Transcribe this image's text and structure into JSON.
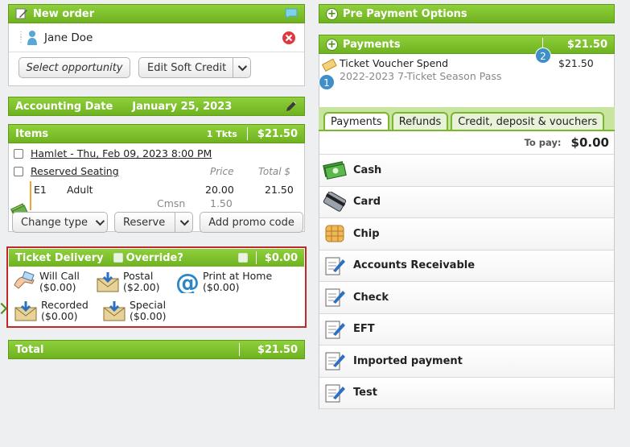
{
  "new_order": {
    "title": "New order",
    "customer": "Jane Doe",
    "select_opportunity": "Select opportunity",
    "edit_soft_credit": "Edit Soft Credit"
  },
  "accounting": {
    "label": "Accounting Date",
    "date": "January 25, 2023"
  },
  "items": {
    "title": "Items",
    "tkts": "1 Tkts",
    "amount": "$21.50",
    "event": "Hamlet - Thu, Feb 09, 2023 8:00 PM",
    "seating": "Reserved Seating",
    "price_header": "Price",
    "total_header": "Total $",
    "seat": "E1",
    "type": "Adult",
    "price": "20.00",
    "total": "21.50",
    "cmsn_label": "Cmsn",
    "cmsn_value": "1.50",
    "change_type": "Change type",
    "reserve": "Reserve",
    "add_promo": "Add promo code"
  },
  "delivery": {
    "title": "Ticket Delivery",
    "override": "Override?",
    "amount": "$0.00",
    "options": [
      {
        "name": "Will Call",
        "price": "($0.00)"
      },
      {
        "name": "Postal",
        "price": "($2.00)"
      },
      {
        "name": "Print at Home",
        "price": "($0.00)"
      },
      {
        "name": "Recorded",
        "price": "($0.00)"
      },
      {
        "name": "Special",
        "price": "($0.00)"
      }
    ]
  },
  "total": {
    "label": "Total",
    "amount": "$21.50"
  },
  "prepay": {
    "title": "Pre Payment Options"
  },
  "payments": {
    "title": "Payments",
    "amount": "$21.50",
    "line_title": "Ticket Voucher Spend",
    "line_sub": "2022-2023 7-Ticket Season Pass",
    "line_amount": "$21.50",
    "badge1": "1",
    "badge2": "2"
  },
  "tabs": [
    "Payments",
    "Refunds",
    "Credit, deposit & vouchers"
  ],
  "to_pay": {
    "label": "To pay:",
    "amount": "$0.00"
  },
  "methods": [
    "Cash",
    "Card",
    "Chip",
    "Accounts Receivable",
    "Check",
    "EFT",
    "Imported payment",
    "Test"
  ],
  "colors": {
    "accent_green": "#7cc02a",
    "delivery_border": "#c0282a",
    "badge_blue": "#3f90c9"
  }
}
